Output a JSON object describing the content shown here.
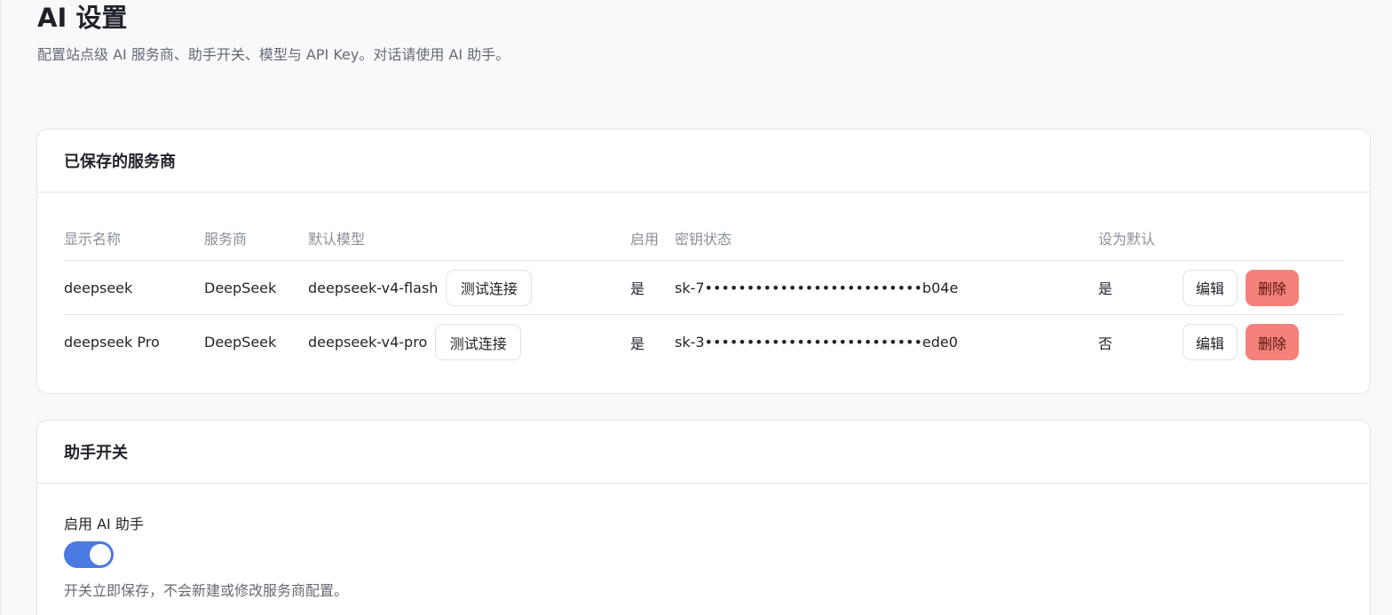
{
  "page": {
    "title": "AI 设置",
    "description": "配置站点级 AI 服务商、助手开关、模型与 API Key。对话请使用 AI 助手。"
  },
  "providers": {
    "title": "已保存的服务商",
    "columns": {
      "name": "显示名称",
      "vendor": "服务商",
      "model": "默认模型",
      "enabled": "启用",
      "key_status": "密钥状态",
      "default": "设为默认"
    },
    "test_label": "测试连接",
    "edit_label": "编辑",
    "delete_label": "删除",
    "rows": [
      {
        "name": "deepseek",
        "vendor": "DeepSeek",
        "model": "deepseek-v4-flash",
        "enabled": "是",
        "key": "sk-7••••••••••••••••••••••••••b04e",
        "default": "是"
      },
      {
        "name": "deepseek Pro",
        "vendor": "DeepSeek",
        "model": "deepseek-v4-pro",
        "enabled": "是",
        "key": "sk-3••••••••••••••••••••••••••ede0",
        "default": "否"
      }
    ]
  },
  "assistant": {
    "title": "助手开关",
    "toggle_label": "启用 AI 助手",
    "toggle_on": true,
    "help": "开关立即保存，不会新建或修改服务商配置。"
  },
  "colors": {
    "accent": "#4a79e0",
    "danger": "#f4827a"
  }
}
